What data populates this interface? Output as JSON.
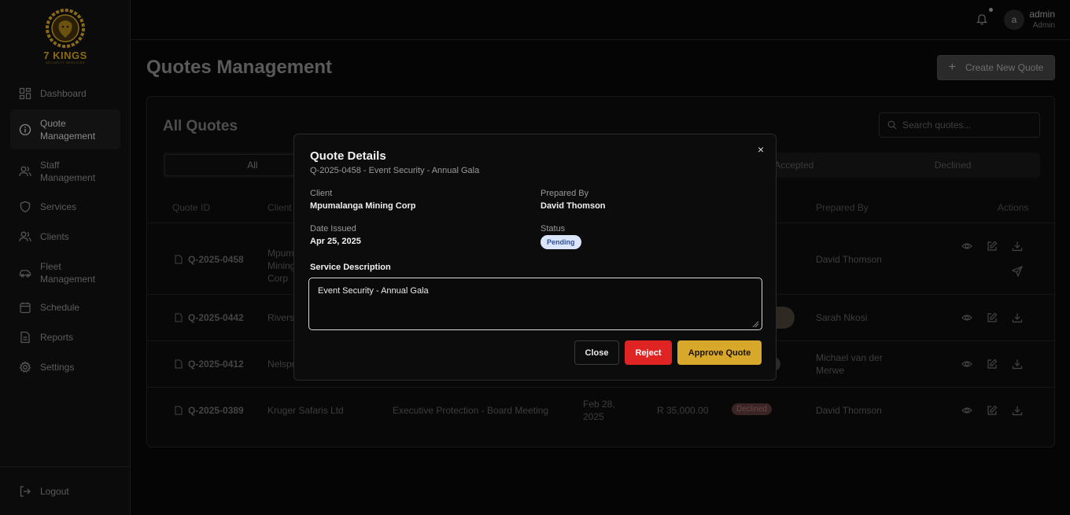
{
  "brand": {
    "name": "7 KINGS",
    "tagline": "SECURITY SERVICES"
  },
  "sidebar": {
    "items": [
      {
        "label": "Dashboard",
        "icon": "dashboard-icon"
      },
      {
        "label": "Quote Management",
        "icon": "info-circle-icon"
      },
      {
        "label": "Staff Management",
        "icon": "users-icon"
      },
      {
        "label": "Services",
        "icon": "shield-icon"
      },
      {
        "label": "Clients",
        "icon": "users-icon"
      },
      {
        "label": "Fleet Management",
        "icon": "car-icon"
      },
      {
        "label": "Schedule",
        "icon": "calendar-icon"
      },
      {
        "label": "Reports",
        "icon": "file-icon"
      },
      {
        "label": "Settings",
        "icon": "gear-icon"
      }
    ],
    "logout": "Logout"
  },
  "topbar": {
    "avatar_letter": "a",
    "user_name": "admin",
    "user_role": "Admin"
  },
  "main": {
    "title": "Quotes Management",
    "create_button": "Create New Quote",
    "card_title": "All Quotes",
    "search_placeholder": "Search quotes...",
    "tabs": [
      "All",
      "",
      "",
      "Accepted",
      "Declined"
    ],
    "headers": {
      "quote_id": "Quote ID",
      "client": "Client",
      "prepared_by": "Prepared By",
      "actions": "Actions"
    },
    "rows": [
      {
        "id": "Q-2025-0458",
        "client": "Mpumalanga Mining Corp",
        "prepared_by": "David Thomson"
      },
      {
        "id": "Q-2025-0442",
        "client": "Riverside",
        "prepared_by": "Sarah Nkosi"
      },
      {
        "id": "Q-2025-0412",
        "client": "Nelspruit",
        "prepared_by": "Michael van der Merwe"
      },
      {
        "id": "Q-2025-0389",
        "client": "Kruger Safaris Ltd",
        "service": "Executive Protection - Board Meeting",
        "date": "Feb 28, 2025",
        "amount": "R 35,000.00",
        "status": "Declined",
        "prepared_by": "David Thomson"
      }
    ]
  },
  "modal": {
    "title": "Quote Details",
    "subtitle": "Q-2025-0458 - Event Security - Annual Gala",
    "client_label": "Client",
    "client_value": "Mpumalanga Mining Corp",
    "prepared_label": "Prepared By",
    "prepared_value": "David Thomson",
    "date_label": "Date Issued",
    "date_value": "Apr 25, 2025",
    "status_label": "Status",
    "status_value": "Pending",
    "desc_label": "Service Description",
    "desc_value": "Event Security - Annual Gala",
    "close_btn": "Close",
    "reject_btn": "Reject",
    "approve_btn": "Approve Quote",
    "close_icon": "×"
  },
  "colors": {
    "accent_gold": "#d8a82a",
    "reject_red": "#e02424",
    "pending_bg": "#dbe6fb"
  }
}
